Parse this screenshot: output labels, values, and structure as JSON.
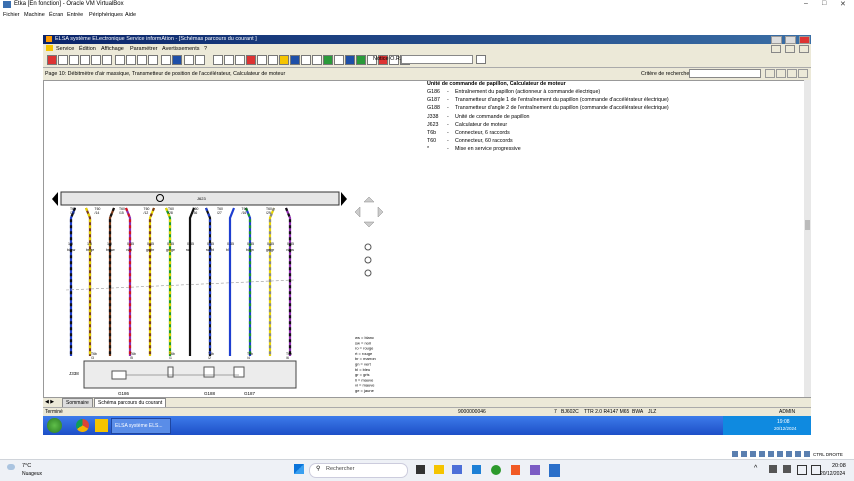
{
  "vbox": {
    "title": "Etka [En fonction] - Oracle VM VirtualBox",
    "menu": [
      "Fichier",
      "Machine",
      "Écran",
      "Entrée",
      "Périphériques",
      "Aide"
    ]
  },
  "elsa": {
    "title": "ELSA système ELectronique Service informAtion - [Schémas parcours du courant ]",
    "menu": [
      "Service",
      "Édition",
      "Affichage",
      "Paramétrer",
      "Avertissements",
      "?"
    ],
    "notice_label": "Notice O.R.:",
    "page_label": "Page 10: Débitmètre d'air massique, Transmetteur de position de l'accélérateur, Calculateur de moteur",
    "search_label": "Critère de recherche:"
  },
  "legend": {
    "header": "Unité de commande de papillon, Calculateur de moteur",
    "rows": [
      {
        "code": "G186",
        "text": "Entraînement du papillon (actionneur à commande électrique)"
      },
      {
        "code": "G187",
        "text": "Transmetteur d'angle 1 de l'entraînement du papillon (commande d'accélérateur électrique)"
      },
      {
        "code": "G188",
        "text": "Transmetteur d'angle 2 de l'entraînement du papillon (commande d'accélérateur électrique)"
      },
      {
        "code": "J338",
        "text": "Unité de commande de papillon"
      },
      {
        "code": "J623",
        "text": "Calculateur de moteur"
      },
      {
        "code": "T6b",
        "text": "Connecteur, 6 raccords"
      },
      {
        "code": "T60",
        "text": "Connecteur, 60 raccords"
      },
      {
        "code": "*",
        "text": "Mise en service progressive"
      }
    ]
  },
  "diagram": {
    "top_label": "J623",
    "top_pins": [
      "T60\n/30",
      "T60\n/14",
      "T60\n/15",
      "T60\n/12",
      "T60\n/28",
      "T60\n/36",
      "T60\n/27",
      "T60\n/16",
      "T60\n/29"
    ],
    "wire_sizes": [
      "1.0",
      "1.0",
      "1.0",
      "0.35",
      "0.35",
      "0.35",
      "0.35",
      "0.35",
      "0.35",
      "0.35",
      "0.35",
      "0.35"
    ],
    "wire_colors": [
      "bl/sw",
      "br/ge",
      "br/sw",
      "vi/rt",
      "ge/br",
      "gn/ge",
      "sw",
      "sw/bl",
      "bl",
      "bl/gn",
      "ge/gr",
      "vi/sw"
    ],
    "bottom_pins": [
      "T6b\n/3",
      "T6b\n/5",
      "T6b\n/1",
      "T6b\n/2",
      "T6b\n/4",
      "T6b\n/6"
    ],
    "bottom_module": "J338",
    "comp_labels": [
      "G186",
      "G188",
      "G187"
    ],
    "color_codes": [
      "ws = blanc",
      "sw = noir",
      "ro = rouge",
      "rt = rouge",
      "br = marron",
      "gn = vert",
      "bl = bleu",
      "gr = gris",
      "li = mauve",
      "vi = mauve",
      "ge = jaune"
    ]
  },
  "tabs": [
    "Sommaire",
    "Schéma parcours du courant"
  ],
  "status": {
    "left": "Terminé",
    "num": "9000000046",
    "n": "7",
    "code": "BJ602C",
    "engine": "TTR 2.0 R4147 M65",
    "mkb": "BWA",
    "jlz": "JLZ",
    "user": "ADMIN"
  },
  "guest_taskbar": {
    "app": "ELSA système ELS...",
    "time": "19:08",
    "date": "20/12/2024"
  },
  "host_taskbar": {
    "weather_temp": "7°C",
    "weather_desc": "Nuageux",
    "search": "Rechercher",
    "ctrl": "CTRL DROITE",
    "time": "20:08",
    "date": "20/12/2024"
  },
  "colors": {
    "titlebar": "#0a246a",
    "guest_taskbar": "#245edb",
    "host_taskbar": "#eef1f6"
  }
}
